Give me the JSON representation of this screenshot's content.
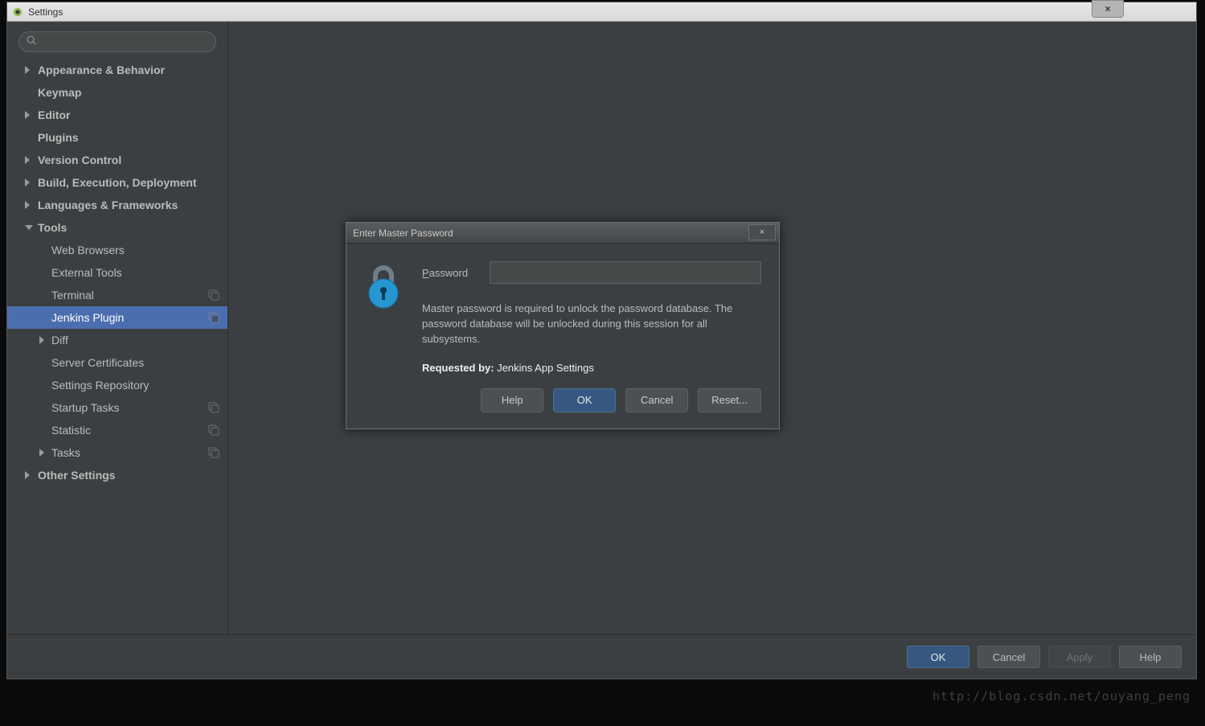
{
  "window": {
    "title": "Settings",
    "close_glyph": "×"
  },
  "sidebar": {
    "search_placeholder": "",
    "items": [
      {
        "label": "Appearance & Behavior",
        "arrow": "right",
        "top": true
      },
      {
        "label": "Keymap",
        "arrow": "",
        "top": true
      },
      {
        "label": "Editor",
        "arrow": "right",
        "top": true
      },
      {
        "label": "Plugins",
        "arrow": "",
        "top": true
      },
      {
        "label": "Version Control",
        "arrow": "right",
        "top": true
      },
      {
        "label": "Build, Execution, Deployment",
        "arrow": "right",
        "top": true
      },
      {
        "label": "Languages & Frameworks",
        "arrow": "right",
        "top": true
      },
      {
        "label": "Tools",
        "arrow": "down",
        "top": true
      },
      {
        "label": "Web Browsers",
        "child": true
      },
      {
        "label": "External Tools",
        "child": true
      },
      {
        "label": "Terminal",
        "child": true,
        "badge": true
      },
      {
        "label": "Jenkins Plugin",
        "child": true,
        "badge": true,
        "selected": true
      },
      {
        "label": "Diff",
        "child": true,
        "arrow": "right"
      },
      {
        "label": "Server Certificates",
        "child": true
      },
      {
        "label": "Settings Repository",
        "child": true
      },
      {
        "label": "Startup Tasks",
        "child": true,
        "badge": true
      },
      {
        "label": "Statistic",
        "child": true,
        "badge": true
      },
      {
        "label": "Tasks",
        "child": true,
        "arrow": "right",
        "badge": true
      },
      {
        "label": "Other Settings",
        "arrow": "right",
        "top": true
      }
    ]
  },
  "footer": {
    "ok": "OK",
    "cancel": "Cancel",
    "apply": "Apply",
    "help": "Help"
  },
  "dialog": {
    "title": "Enter Master Password",
    "close_glyph": "×",
    "password_label_first": "P",
    "password_label_rest": "assword",
    "message": "Master password is required to unlock the password database. The password database will be unlocked during this session for all subsystems.",
    "requested_by_label": "Requested by:",
    "requested_by_value": "Jenkins App Settings",
    "buttons": {
      "help": "Help",
      "ok": "OK",
      "cancel": "Cancel",
      "reset": "Reset..."
    }
  },
  "watermark": "http://blog.csdn.net/ouyang_peng"
}
